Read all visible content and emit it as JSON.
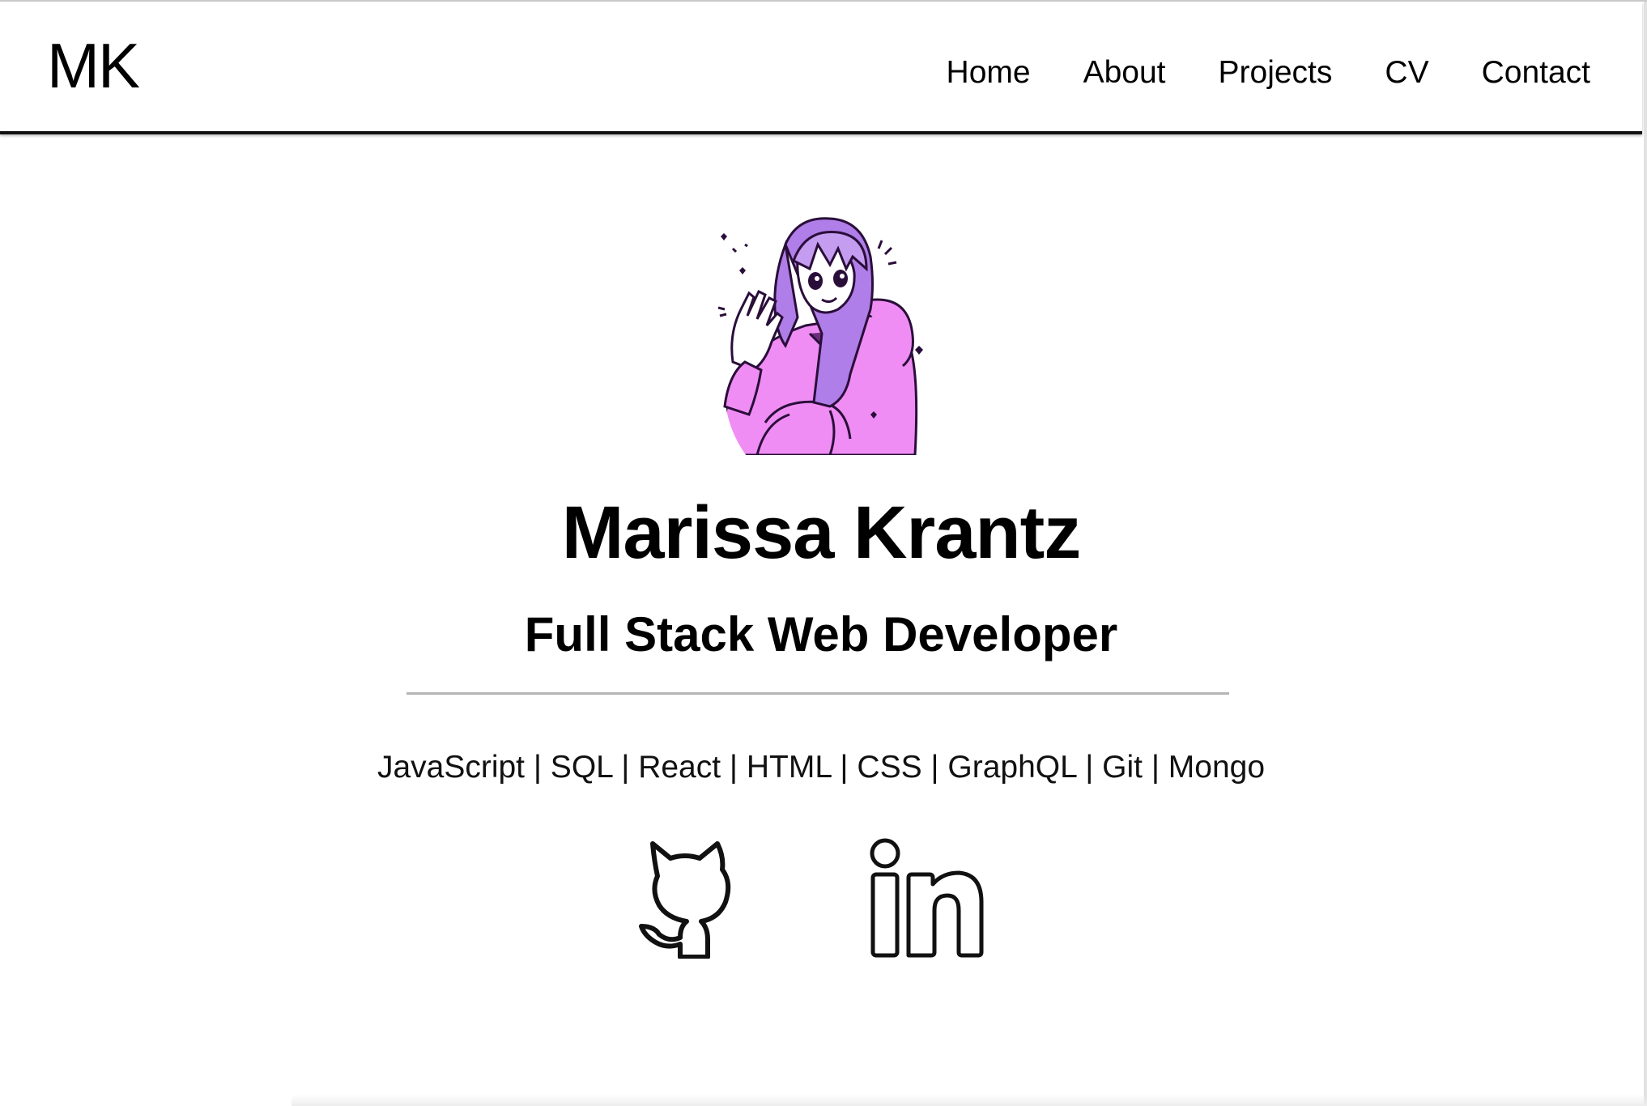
{
  "header": {
    "brand": "MK",
    "nav": [
      {
        "label": "Home"
      },
      {
        "label": "About"
      },
      {
        "label": "Projects"
      },
      {
        "label": "CV"
      },
      {
        "label": "Contact"
      }
    ]
  },
  "hero": {
    "name": "Marissa Krantz",
    "role": "Full Stack Web Developer",
    "skills": "JavaScript | SQL | React | HTML | CSS | GraphQL | Git | Mongo"
  },
  "social": [
    {
      "icon": "github-icon"
    },
    {
      "icon": "linkedin-icon"
    }
  ],
  "colors": {
    "accent": "#f08df4",
    "ink": "#2a0e3a",
    "text": "#000000",
    "divider": "#b5b5b5"
  }
}
